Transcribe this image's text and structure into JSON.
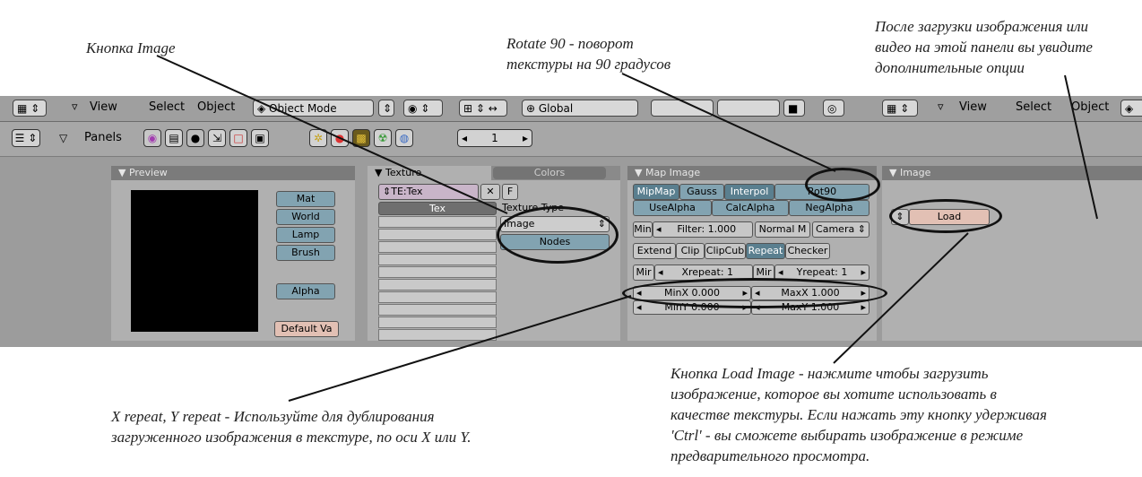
{
  "annotations": {
    "image_button": "Кнопка Image",
    "rot90_line1": "Rotate 90 - поворот",
    "rot90_line2": "текстуры на 90 градусов",
    "after_load_line1": "После загрузки изображения или",
    "after_load_line2": "видео на этой панели вы увидите",
    "after_load_line3": "дополнительные опции",
    "repeat_line1": "X repeat, Y repeat - Используйте для дублирования",
    "repeat_line2": "загруженного изображения в текстуре, по оси X или Y.",
    "load_line1": "Кнопка Load Image - нажмите чтобы загрузить",
    "load_line2": "изображение, которое вы хотите использовать в",
    "load_line3": "качестве текстуры. Если нажать эту кнопку удерживая",
    "load_line4": "'Ctrl' - вы сможете выбирать изображение в режиме",
    "load_line5": "предварительного просмотра."
  },
  "header": {
    "view": "View",
    "select": "Select",
    "object": "Object",
    "mode": "Object Mode",
    "orientation": "Global",
    "view2": "View",
    "select2": "Select",
    "object2": "Object"
  },
  "panels_header": {
    "label": "Panels",
    "frame": "1"
  },
  "preview": {
    "title": "Preview",
    "buttons": [
      "Mat",
      "World",
      "Lamp",
      "Brush"
    ],
    "alpha": "Alpha",
    "default": "Default Va"
  },
  "texture": {
    "tab_texture": "Texture",
    "tab_colors": "Colors",
    "name": "TE:Tex",
    "x": "✕",
    "f": "F",
    "tex_header": "Tex",
    "type_label": "Texture Type",
    "type_value": "Image",
    "nodes": "Nodes"
  },
  "map_image": {
    "title": "Map Image",
    "row1": [
      "MipMap",
      "Gauss",
      "Interpol",
      "Rot90"
    ],
    "row2": [
      "UseAlpha",
      "CalcAlpha",
      "NegAlpha"
    ],
    "min": "Min",
    "filter": "Filter: 1.000",
    "normal": "Normal M",
    "camera": "Camera",
    "row4": [
      "Extend",
      "Clip",
      "ClipCub",
      "Repeat",
      "Checker"
    ],
    "mir": "Mir",
    "xrepeat": "Xrepeat: 1",
    "mir2": "Mir",
    "yrepeat": "Yrepeat: 1",
    "minx": "MinX 0.000",
    "maxx": "MaxX 1.000",
    "miny": "MinY 0.000",
    "maxy": "MaxY 1.000"
  },
  "image_panel": {
    "title": "Image",
    "load": "Load"
  }
}
